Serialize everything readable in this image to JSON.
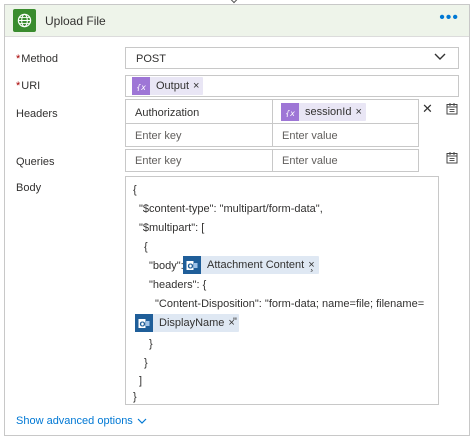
{
  "action": {
    "title": "Upload File",
    "more_label": "•••"
  },
  "fields": {
    "method": {
      "label": "Method",
      "required_mark": "*",
      "value": "POST"
    },
    "uri": {
      "label": "URI",
      "required_mark": "*",
      "token": "Output",
      "token_remove": "×"
    },
    "headers": {
      "label": "Headers",
      "row1_key": "Authorization",
      "row1_token": "sessionId",
      "row1_token_remove": "×",
      "key_placeholder": "Enter key",
      "value_placeholder": "Enter value",
      "delete_label": "✕"
    },
    "queries": {
      "label": "Queries",
      "key_placeholder": "Enter key",
      "value_placeholder": "Enter value"
    },
    "body": {
      "label": "Body",
      "lines": {
        "l1": "{",
        "l2": "\"$content-type\": \"multipart/form-data\",",
        "l3": "\"$multipart\": [",
        "l4": "{",
        "l5_prefix": "\"body\":",
        "l5_token": "Attachment Content",
        "l5_suffix": "¸",
        "l6": "\"headers\": {",
        "l7": "\"Content-Disposition\": \"form-data; name=file; filename=",
        "l8_token": "DisplayName",
        "l8_suffix": "\"",
        "l9": "}",
        "l10": "}",
        "l11": "]",
        "l12": "}"
      },
      "token_remove": "×"
    }
  },
  "footer": {
    "advanced_label": "Show advanced options"
  },
  "colors": {
    "header_bg": "#eef4ea",
    "brand_green": "#3a8c2e",
    "link_blue": "#0078d4",
    "expression_purple": "#9e76d6",
    "outlook_blue": "#1f5e99"
  }
}
